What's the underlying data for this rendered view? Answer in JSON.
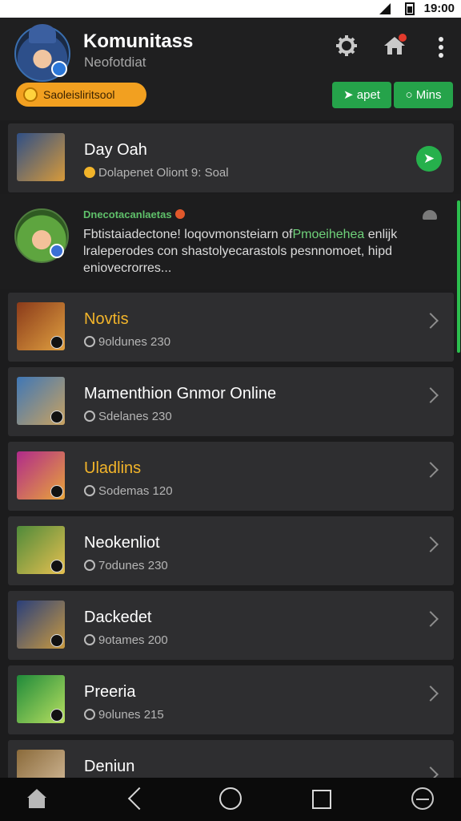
{
  "status_bar": {
    "time": "19:00"
  },
  "header": {
    "title": "Komunitass",
    "subtitle": "Neofotdiat",
    "badge_label": "Saoleisliritsool",
    "buttons": [
      {
        "label": "apet",
        "icon": "chat-icon"
      },
      {
        "label": "Mins",
        "icon": "circle-icon"
      }
    ],
    "icons": [
      "settings-gear-icon",
      "home-icon",
      "more-vertical-icon"
    ]
  },
  "top_card": {
    "name": "Day Oah",
    "meta": "Dolapenet Oliont 9: Soal"
  },
  "message": {
    "sender": "Dnecotacanlaetas",
    "text_before": "Fbtistaiadectone! loqovmonsteiarn of",
    "text_highlight": "Pmoeihehea",
    "text_after": " enlijk lraleperodes con shastolyecarastols pesnnomoet, hipd eniovecrorres..."
  },
  "items": [
    {
      "name": "Novtis",
      "meta": "9oldunes 230",
      "gold": true
    },
    {
      "name": "Mamenthion Gnmor Online",
      "meta": "Sdelanes 230",
      "gold": false
    },
    {
      "name": "Uladlins",
      "meta": "Sodemas 120",
      "gold": true
    },
    {
      "name": "Neokenliot",
      "meta": "7odunes 230",
      "gold": false
    },
    {
      "name": "Dackedet",
      "meta": "9otames 200",
      "gold": false
    },
    {
      "name": "Preeria",
      "meta": "9olunes 215",
      "gold": false
    },
    {
      "name": "Deniun",
      "meta": "",
      "gold": false
    }
  ],
  "colors": {
    "accent_green": "#25a34a",
    "accent_orange": "#f2a020",
    "gold_text": "#f2b42a"
  }
}
